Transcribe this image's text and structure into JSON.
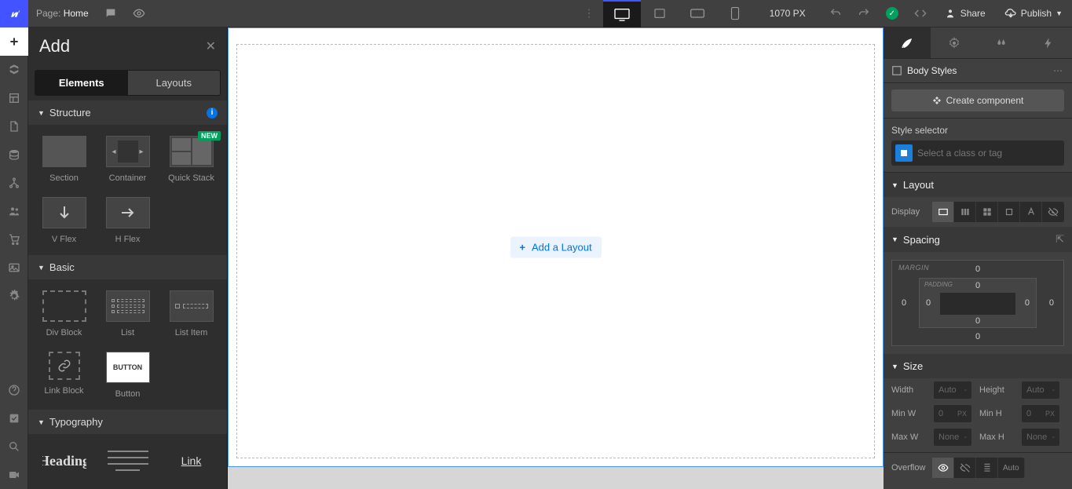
{
  "topbar": {
    "page_prefix": "Page:",
    "page_name": "Home",
    "center_px": "1070 PX",
    "share": "Share",
    "publish": "Publish"
  },
  "add_panel": {
    "title": "Add",
    "tabs": {
      "elements": "Elements",
      "layouts": "Layouts"
    },
    "sections": {
      "structure": "Structure",
      "basic": "Basic",
      "typography": "Typography"
    },
    "items": {
      "section": "Section",
      "container": "Container",
      "quickstack": "Quick Stack",
      "vflex": "V Flex",
      "hflex": "H Flex",
      "divblock": "Div Block",
      "list": "List",
      "listitem": "List Item",
      "linkblock": "Link Block",
      "button": "Button",
      "button_thumb": "BUTTON",
      "heading": "Heading",
      "link": "Link",
      "new_badge": "NEW"
    }
  },
  "canvas": {
    "add_layout": "Add a Layout"
  },
  "right_panel": {
    "body_styles": "Body Styles",
    "create_component": "Create component",
    "style_selector": "Style selector",
    "selector_placeholder": "Select a class or tag",
    "layout": "Layout",
    "display": "Display",
    "spacing": "Spacing",
    "margin_label": "MARGIN",
    "padding_label": "PADDING",
    "spacing_vals": {
      "m_top": "0",
      "m_right": "0",
      "m_bottom": "0",
      "m_left": "0",
      "p_top": "0",
      "p_right": "0",
      "p_bottom": "0",
      "p_left": "0"
    },
    "size": "Size",
    "width": "Width",
    "width_val": "Auto",
    "height": "Height",
    "height_val": "Auto",
    "minw": "Min W",
    "minw_val": "0",
    "minw_unit": "PX",
    "minh": "Min H",
    "minh_val": "0",
    "minh_unit": "PX",
    "maxw": "Max W",
    "maxw_val": "None",
    "maxh": "Max H",
    "maxh_val": "None",
    "overflow": "Overflow",
    "overflow_auto": "Auto"
  }
}
